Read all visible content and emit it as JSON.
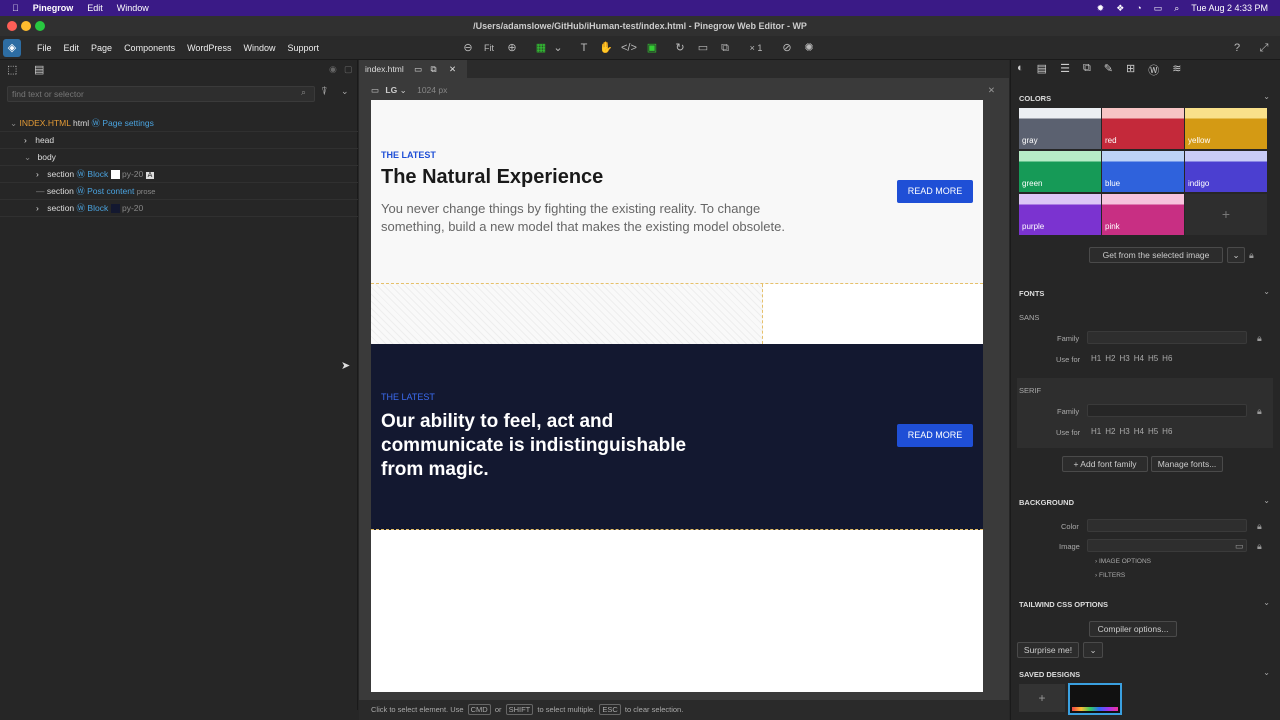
{
  "macbar": {
    "app": "Pinegrow",
    "menu": [
      "Edit",
      "Window"
    ],
    "datetime": "Tue Aug 2  4:33 PM"
  },
  "window": {
    "title": "/Users/adamslowe/GitHub/iHuman-test/index.html - Pinegrow Web Editor - WP"
  },
  "menubar": {
    "items": [
      "File",
      "Edit",
      "Page",
      "Components",
      "WordPress",
      "Window",
      "Support"
    ],
    "zoom_fit": "Fit",
    "multiplier": "× 1"
  },
  "left": {
    "search_placeholder": "find text or selector",
    "tree": {
      "root_file": "INDEX.HTML",
      "root_tag": "html",
      "page_settings": "Page settings",
      "head": "head",
      "body": "body",
      "rows": [
        {
          "tag": "section",
          "kind": "Block",
          "cls": "py-20",
          "badge": "A"
        },
        {
          "tag": "section",
          "kind": "Post content",
          "cls": "prose"
        },
        {
          "tag": "section",
          "kind": "Block",
          "cls": "py-20"
        }
      ]
    }
  },
  "canvas": {
    "tab": "index.html",
    "device": "LG",
    "width": "1024 px",
    "sec1": {
      "kicker": "THE LATEST",
      "title": "The Natural Experience",
      "body": "You never change things by fighting the existing reality. To change something, build a new model that makes the existing model obsolete.",
      "button": "READ MORE"
    },
    "sec3": {
      "kicker": "THE LATEST",
      "title": "Our ability to feel, act and communicate is indistinguishable from magic.",
      "button": "READ MORE"
    }
  },
  "right": {
    "colors_title": "COLORS",
    "swatches": [
      {
        "name": "gray",
        "top": "#eceff3",
        "bottom": "#5b6170"
      },
      {
        "name": "red",
        "top": "#f7c5c5",
        "bottom": "#c4293a"
      },
      {
        "name": "yellow",
        "top": "#f9e08a",
        "bottom": "#d49a14"
      },
      {
        "name": "green",
        "top": "#b6ecc7",
        "bottom": "#169a57"
      },
      {
        "name": "blue",
        "top": "#bcd3f7",
        "bottom": "#2f62dc"
      },
      {
        "name": "indigo",
        "top": "#c9ccf7",
        "bottom": "#4b3fd0"
      },
      {
        "name": "purple",
        "top": "#dcc6f6",
        "bottom": "#7b33d0"
      },
      {
        "name": "pink",
        "top": "#f6c3dd",
        "bottom": "#c82f83"
      }
    ],
    "get_from_image": "Get from the selected image",
    "fonts_title": "FONTS",
    "sans": "SANS",
    "serif": "SERIF",
    "family": "Family",
    "use_for": "Use for",
    "headings": [
      "H1",
      "H2",
      "H3",
      "H4",
      "H5",
      "H6"
    ],
    "add_font": "+ Add font family",
    "manage_fonts": "Manage fonts...",
    "background_title": "BACKGROUND",
    "color": "Color",
    "image": "Image",
    "image_options": "IMAGE OPTIONS",
    "filters": "FILTERS",
    "tailwind_title": "TAILWIND CSS OPTIONS",
    "compiler": "Compiler options...",
    "surprise": "Surprise me!",
    "saved_title": "SAVED DESIGNS"
  },
  "status": {
    "p1": "Click to select element. Use",
    "k1": "CMD",
    "p2": "or",
    "k2": "SHIFT",
    "p3": "to select multiple.",
    "k3": "ESC",
    "p4": "to clear selection."
  }
}
